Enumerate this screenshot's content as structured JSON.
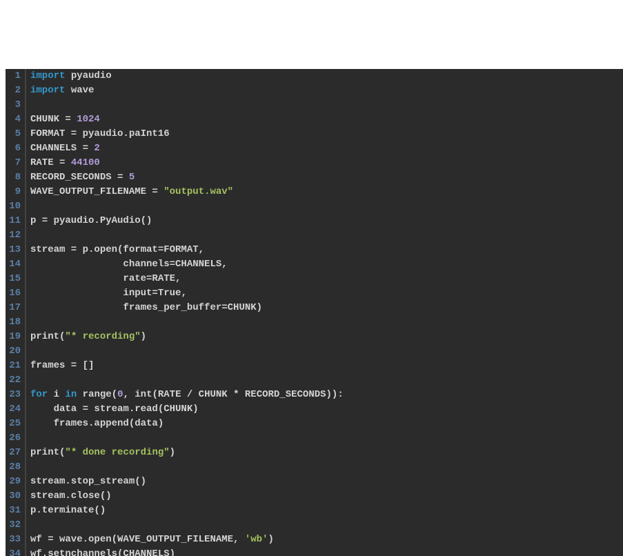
{
  "code_lines": [
    {
      "n": 1,
      "tokens": [
        {
          "t": "import",
          "c": "keyword"
        },
        {
          "t": " pyaudio",
          "c": "ident"
        }
      ]
    },
    {
      "n": 2,
      "tokens": [
        {
          "t": "import",
          "c": "keyword"
        },
        {
          "t": " wave",
          "c": "ident"
        }
      ]
    },
    {
      "n": 3,
      "tokens": []
    },
    {
      "n": 4,
      "tokens": [
        {
          "t": "CHUNK = ",
          "c": "ident"
        },
        {
          "t": "1024",
          "c": "number"
        }
      ]
    },
    {
      "n": 5,
      "tokens": [
        {
          "t": "FORMAT = pyaudio.paInt16",
          "c": "ident"
        }
      ]
    },
    {
      "n": 6,
      "tokens": [
        {
          "t": "CHANNELS = ",
          "c": "ident"
        },
        {
          "t": "2",
          "c": "number"
        }
      ]
    },
    {
      "n": 7,
      "tokens": [
        {
          "t": "RATE = ",
          "c": "ident"
        },
        {
          "t": "44100",
          "c": "number"
        }
      ]
    },
    {
      "n": 8,
      "tokens": [
        {
          "t": "RECORD_SECONDS = ",
          "c": "ident"
        },
        {
          "t": "5",
          "c": "number"
        }
      ]
    },
    {
      "n": 9,
      "tokens": [
        {
          "t": "WAVE_OUTPUT_FILENAME = ",
          "c": "ident"
        },
        {
          "t": "\"output.wav\"",
          "c": "string"
        }
      ]
    },
    {
      "n": 10,
      "tokens": []
    },
    {
      "n": 11,
      "tokens": [
        {
          "t": "p = pyaudio.PyAudio()",
          "c": "ident"
        }
      ]
    },
    {
      "n": 12,
      "tokens": []
    },
    {
      "n": 13,
      "tokens": [
        {
          "t": "stream = p.open(format=FORMAT,",
          "c": "ident"
        }
      ]
    },
    {
      "n": 14,
      "tokens": [
        {
          "t": "                channels=CHANNELS,",
          "c": "ident"
        }
      ]
    },
    {
      "n": 15,
      "tokens": [
        {
          "t": "                rate=RATE,",
          "c": "ident"
        }
      ]
    },
    {
      "n": 16,
      "tokens": [
        {
          "t": "                input=",
          "c": "ident"
        },
        {
          "t": "True",
          "c": "ident"
        },
        {
          "t": ",",
          "c": "ident"
        }
      ]
    },
    {
      "n": 17,
      "tokens": [
        {
          "t": "                frames_per_buffer=CHUNK)",
          "c": "ident"
        }
      ]
    },
    {
      "n": 18,
      "tokens": []
    },
    {
      "n": 19,
      "tokens": [
        {
          "t": "print(",
          "c": "ident"
        },
        {
          "t": "\"* recording\"",
          "c": "string"
        },
        {
          "t": ")",
          "c": "ident"
        }
      ]
    },
    {
      "n": 20,
      "tokens": []
    },
    {
      "n": 21,
      "tokens": [
        {
          "t": "frames = []",
          "c": "ident"
        }
      ]
    },
    {
      "n": 22,
      "tokens": []
    },
    {
      "n": 23,
      "tokens": [
        {
          "t": "for",
          "c": "keyword"
        },
        {
          "t": " i ",
          "c": "ident"
        },
        {
          "t": "in",
          "c": "keyword"
        },
        {
          "t": " range(",
          "c": "ident"
        },
        {
          "t": "0",
          "c": "number"
        },
        {
          "t": ", int(RATE / CHUNK * RECORD_SECONDS)):",
          "c": "ident"
        }
      ]
    },
    {
      "n": 24,
      "tokens": [
        {
          "t": "    data = stream.read(CHUNK)",
          "c": "ident"
        }
      ]
    },
    {
      "n": 25,
      "tokens": [
        {
          "t": "    frames.append(data)",
          "c": "ident"
        }
      ]
    },
    {
      "n": 26,
      "tokens": []
    },
    {
      "n": 27,
      "tokens": [
        {
          "t": "print(",
          "c": "ident"
        },
        {
          "t": "\"* done recording\"",
          "c": "string"
        },
        {
          "t": ")",
          "c": "ident"
        }
      ]
    },
    {
      "n": 28,
      "tokens": []
    },
    {
      "n": 29,
      "tokens": [
        {
          "t": "stream.stop_stream()",
          "c": "ident"
        }
      ]
    },
    {
      "n": 30,
      "tokens": [
        {
          "t": "stream.close()",
          "c": "ident"
        }
      ]
    },
    {
      "n": 31,
      "tokens": [
        {
          "t": "p.terminate()",
          "c": "ident"
        }
      ]
    },
    {
      "n": 32,
      "tokens": []
    },
    {
      "n": 33,
      "tokens": [
        {
          "t": "wf = wave.open(WAVE_OUTPUT_FILENAME, ",
          "c": "ident"
        },
        {
          "t": "'wb'",
          "c": "string"
        },
        {
          "t": ")",
          "c": "ident"
        }
      ]
    },
    {
      "n": 34,
      "tokens": [
        {
          "t": "wf.setnchannels(CHANNELS)",
          "c": "ident"
        }
      ]
    }
  ]
}
